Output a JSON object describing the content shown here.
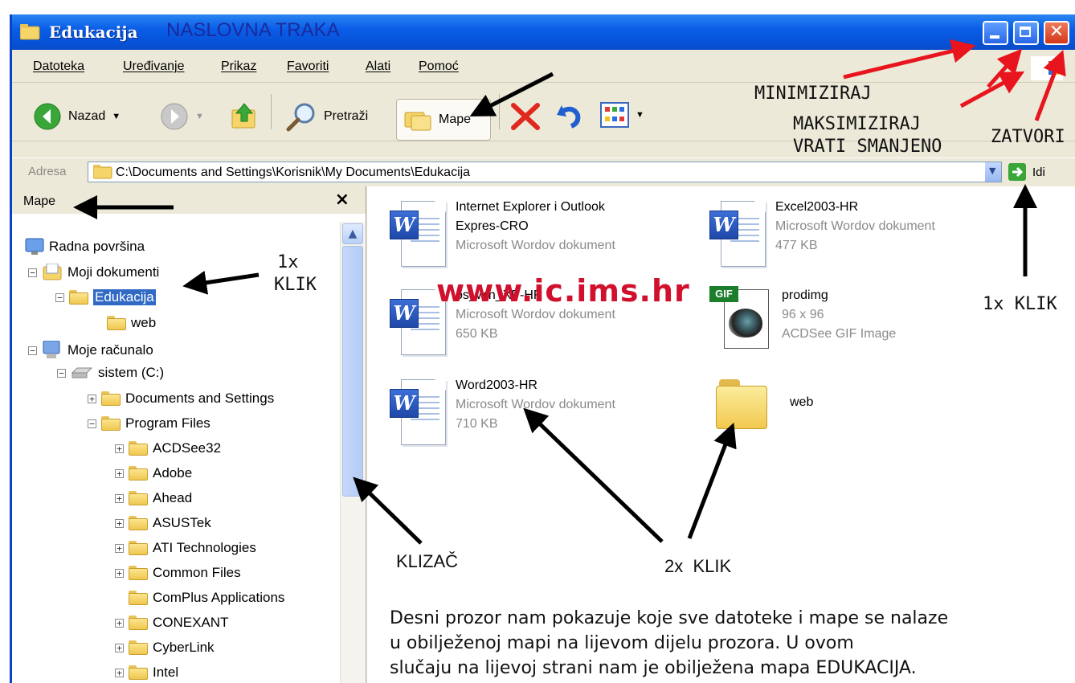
{
  "window": {
    "title": "Edukacija",
    "title_annotation": "NASLOVNA TRAKA"
  },
  "menu": [
    "Datoteka",
    "Uređivanje",
    "Prikaz",
    "Favoriti",
    "Alati",
    "Pomoć"
  ],
  "toolbar": {
    "back": "Nazad",
    "search": "Pretraži",
    "folders": "Mape"
  },
  "address": {
    "label": "Adresa",
    "path": "C:\\Documents and Settings\\Korisnik\\My Documents\\Edukacija",
    "go": "Idi"
  },
  "left_pane": {
    "title": "Mape",
    "close": "×",
    "tree": [
      {
        "label": "Radna površina",
        "expander": "",
        "icon": "desktop-icon"
      },
      {
        "label": "Moji dokumenti",
        "expander": "−",
        "icon": "my-documents-icon"
      },
      {
        "label": "Edukacija",
        "expander": "−",
        "icon": "folder-open-icon",
        "selected": true
      },
      {
        "label": "web",
        "expander": "",
        "icon": "folder-icon"
      },
      {
        "label": "Moje računalo",
        "expander": "−",
        "icon": "my-computer-icon"
      },
      {
        "label": "sistem (C:)",
        "expander": "−",
        "icon": "drive-icon"
      },
      {
        "label": "Documents and Settings",
        "expander": "+",
        "icon": "folder-icon"
      },
      {
        "label": "Program Files",
        "expander": "−",
        "icon": "folder-icon"
      },
      {
        "label": "ACDSee32",
        "expander": "+",
        "icon": "folder-icon"
      },
      {
        "label": "Adobe",
        "expander": "+",
        "icon": "folder-icon"
      },
      {
        "label": "Ahead",
        "expander": "+",
        "icon": "folder-icon"
      },
      {
        "label": "ASUSTek",
        "expander": "+",
        "icon": "folder-icon"
      },
      {
        "label": "ATI Technologies",
        "expander": "+",
        "icon": "folder-icon"
      },
      {
        "label": "Common Files",
        "expander": "+",
        "icon": "folder-icon"
      },
      {
        "label": "ComPlus Applications",
        "expander": "",
        "icon": "folder-icon"
      },
      {
        "label": "CONEXANT",
        "expander": "+",
        "icon": "folder-icon"
      },
      {
        "label": "CyberLink",
        "expander": "+",
        "icon": "folder-icon"
      },
      {
        "label": "Intel",
        "expander": "+",
        "icon": "folder-icon"
      }
    ]
  },
  "files": [
    {
      "name": "Internet Explorer i Outlook",
      "name2": "Expres-CRO",
      "type": "Microsoft Wordov dokument",
      "size": "",
      "icon": "word-document-icon"
    },
    {
      "name": "Excel2003-HR",
      "name2": "",
      "type": "Microsoft Wordov dokument",
      "size": "477 KB",
      "icon": "word-document-icon"
    },
    {
      "name": "os_win_XP-HR",
      "name2": "",
      "type": "Microsoft Wordov dokument",
      "size": "650 KB",
      "icon": "word-document-icon"
    },
    {
      "name": "prodimg",
      "name2": "",
      "type": "96 x 96",
      "size": "ACDSee GIF Image",
      "icon": "gif-image-icon"
    },
    {
      "name": "Word2003-HR",
      "name2": "",
      "type": "Microsoft Wordov dokument",
      "size": "710 KB",
      "icon": "word-document-icon"
    },
    {
      "name": "web",
      "name2": "",
      "type": "",
      "size": "",
      "icon": "folder-icon"
    }
  ],
  "annotations": {
    "minimize": "MINIMIZIRAJ",
    "maximize": "MAKSIMIZIRAJ",
    "restore": "VRATI SMANJENO",
    "close": "ZATVORI",
    "click_once": "1x",
    "klik": "KLIK",
    "click_once_go": "1x KLIK",
    "scroll": "KLIZAČ",
    "double_click": "2x  KLIK",
    "watermark": "www.ic.ims.hr",
    "description": [
      "Desni prozor nam pokazuje koje sve datoteke i mape se nalaze",
      "u obilježenoj mapi na lijevom dijelu prozora. U ovom",
      "slučaju na lijevoj strani nam je obilježena mapa EDUKACIJA."
    ]
  },
  "colors": {
    "titlebar": "#0a5ee8",
    "selection": "#316ac5",
    "watermark": "#d0102c",
    "arrow_red": "#e8141e"
  }
}
